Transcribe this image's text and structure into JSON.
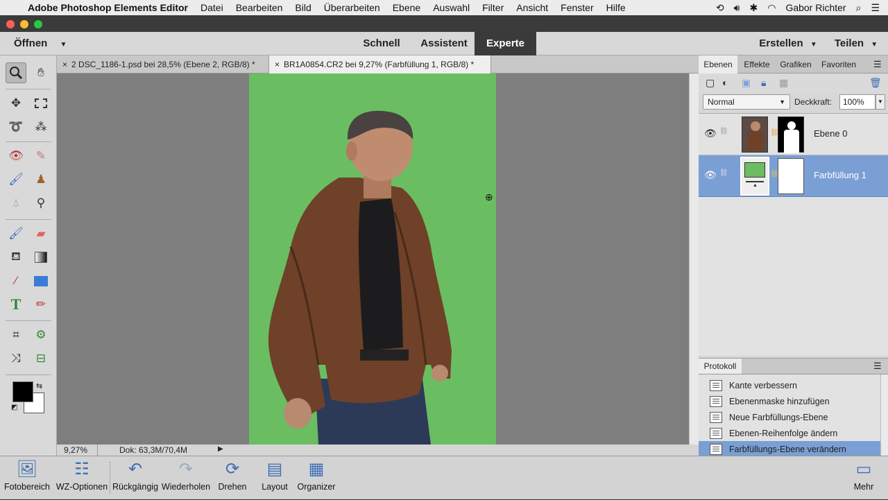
{
  "menubar": {
    "app_name": "Adobe Photoshop Elements Editor",
    "items": [
      "Datei",
      "Bearbeiten",
      "Bild",
      "Überarbeiten",
      "Ebene",
      "Auswahl",
      "Filter",
      "Ansicht",
      "Fenster",
      "Hilfe"
    ],
    "user": "Gabor Richter"
  },
  "modebar": {
    "open_label": "Öffnen",
    "modes": [
      "Schnell",
      "Assistent",
      "Experte"
    ],
    "active_mode": "Experte",
    "create_label": "Erstellen",
    "share_label": "Teilen"
  },
  "tabs": [
    {
      "label": "2 DSC_1186-1.psd bei 28,5% (Ebene 2, RGB/8) *",
      "active": false
    },
    {
      "label": "BR1A0854.CR2 bei 9,27% (Farbfüllung 1, RGB/8) *",
      "active": true
    }
  ],
  "status": {
    "zoom": "9,27%",
    "doc": "Dok: 63,3M/70,4M"
  },
  "panel": {
    "tabs": [
      "Ebenen",
      "Effekte",
      "Grafiken",
      "Favoriten"
    ],
    "blend_mode": "Normal",
    "opacity_label": "Deckkraft:",
    "opacity_value": "100%",
    "layers": [
      {
        "name": "Ebene 0",
        "selected": false
      },
      {
        "name": "Farbfüllung 1",
        "selected": true
      }
    ]
  },
  "history": {
    "title": "Protokoll",
    "items": [
      "Kante verbessern",
      "Ebenenmaske hinzufügen",
      "Neue Farbfüllungs-Ebene",
      "Ebenen-Reihenfolge ändern",
      "Farbfüllungs-Ebene verändern"
    ],
    "selected_index": 4
  },
  "bottombar": {
    "items": [
      "Fotobereich",
      "WZ-Optionen",
      "Rückgängig",
      "Wiederholen",
      "Drehen",
      "Layout",
      "Organizer"
    ],
    "more": "Mehr"
  },
  "colors": {
    "canvas_bg": "#7e7e7e",
    "fill_green": "#6bbd62",
    "selection_blue": "#7a9fd4",
    "active_mode_bg": "#3a3a3a"
  }
}
